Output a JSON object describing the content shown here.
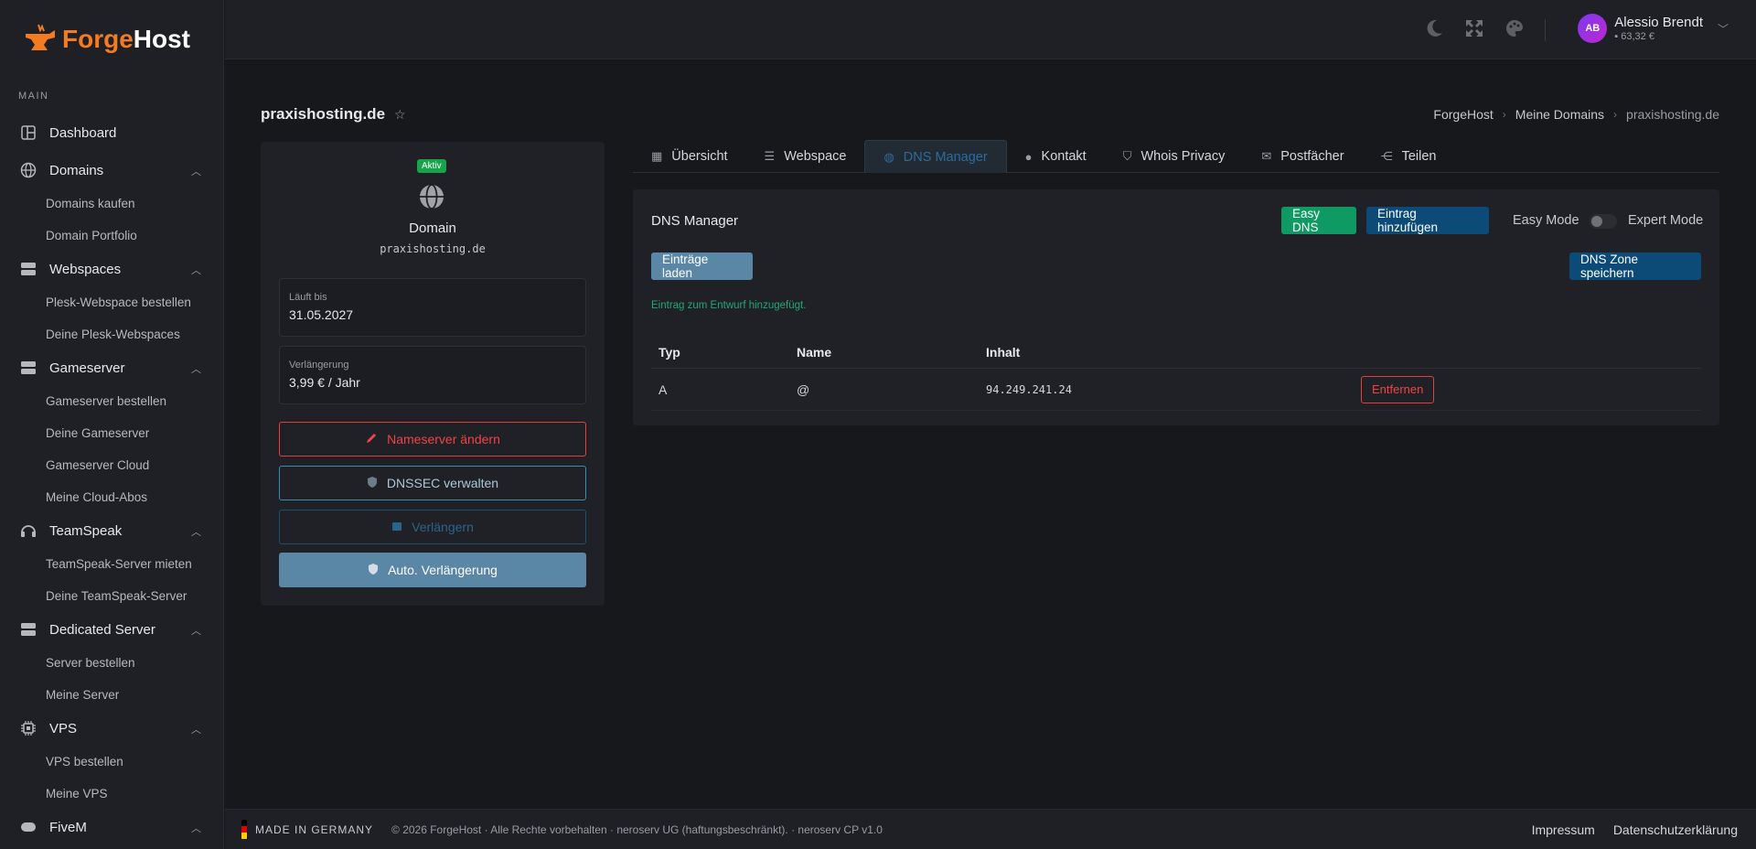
{
  "brand": {
    "part1": "Forge",
    "part2": "Host"
  },
  "sidebar": {
    "section": "MAIN",
    "dashboard": "Dashboard",
    "groups": [
      {
        "label": "Domains",
        "items": [
          "Domains kaufen",
          "Domain Portfolio"
        ]
      },
      {
        "label": "Webspaces",
        "items": [
          "Plesk-Webspace bestellen",
          "Deine Plesk-Webspaces"
        ]
      },
      {
        "label": "Gameserver",
        "items": [
          "Gameserver bestellen",
          "Deine Gameserver",
          "Gameserver Cloud",
          "Meine Cloud-Abos"
        ]
      },
      {
        "label": "TeamSpeak",
        "items": [
          "TeamSpeak-Server mieten",
          "Deine TeamSpeak-Server"
        ]
      },
      {
        "label": "Dedicated Server",
        "items": [
          "Server bestellen",
          "Meine Server"
        ]
      },
      {
        "label": "VPS",
        "items": [
          "VPS bestellen",
          "Meine VPS"
        ]
      },
      {
        "label": "FiveM",
        "items": []
      }
    ]
  },
  "topbar": {
    "user_initials": "AB",
    "user_name": "Alessio Brendt",
    "balance": "63,32 €"
  },
  "page": {
    "title": "praxishosting.de",
    "breadcrumb": [
      "ForgeHost",
      "Meine Domains",
      "praxishosting.de"
    ]
  },
  "domain_card": {
    "status": "Aktiv",
    "label": "Domain",
    "name": "praxishosting.de",
    "expires_label": "Läuft bis",
    "expires_value": "31.05.2027",
    "renewal_label": "Verlängerung",
    "renewal_value": "3,99 € / Jahr",
    "btn_nameserver": "Nameserver ändern",
    "btn_dnssec": "DNSSEC verwalten",
    "btn_extend": "Verlängern",
    "btn_autorenew": "Auto. Verlängerung"
  },
  "tabs": [
    "Übersicht",
    "Webspace",
    "DNS Manager",
    "Kontakt",
    "Whois Privacy",
    "Postfächer",
    "Teilen"
  ],
  "dns": {
    "title": "DNS Manager",
    "btn_easy": "Easy DNS",
    "btn_add": "Eintrag hinzufügen",
    "easy_mode": "Easy Mode",
    "expert_mode": "Expert Mode",
    "btn_load": "Einträge laden",
    "btn_save": "DNS Zone speichern",
    "message": "Eintrag zum Entwurf hinzugefügt.",
    "columns": [
      "Typ",
      "Name",
      "Inhalt"
    ],
    "rows": [
      {
        "type": "A",
        "name": "@",
        "content": "94.249.241.24",
        "action": "Entfernen"
      }
    ]
  },
  "footer": {
    "made": "MADE IN GERMANY",
    "copyright": "© 2026 ForgeHost · Alle Rechte vorbehalten · neroserv UG (haftungsbeschränkt). · neroserv CP v1.0",
    "impressum": "Impressum",
    "privacy": "Datenschutzerklärung"
  },
  "colors": {
    "brand_orange": "#f47b20",
    "accent_blue": "#0c4a77",
    "green": "#0f9a63",
    "danger": "#ef4444"
  }
}
